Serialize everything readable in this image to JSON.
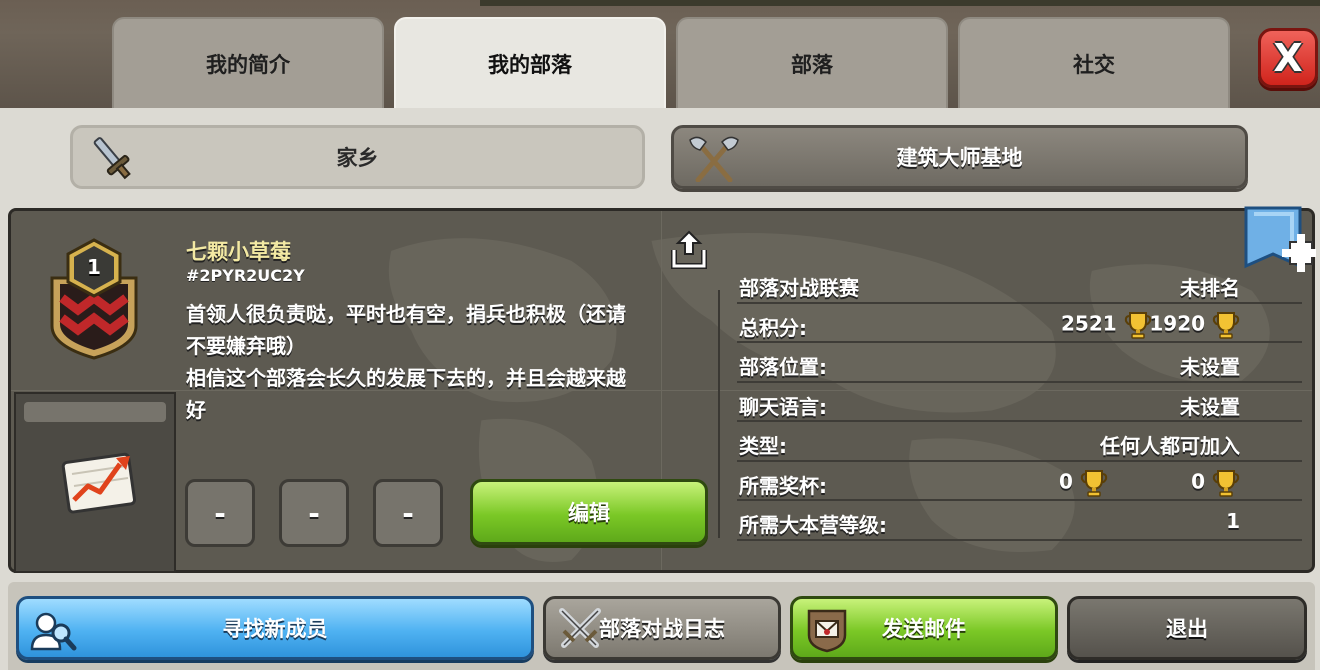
{
  "tabs": [
    {
      "label": "我的简介",
      "active": false
    },
    {
      "label": "我的部落",
      "active": true
    },
    {
      "label": "部落",
      "active": false
    },
    {
      "label": "社交",
      "active": false
    }
  ],
  "close_label": "X",
  "subtabs": {
    "home": {
      "label": "家乡",
      "icon": "sword-icon"
    },
    "builder": {
      "label": "建筑大师基地",
      "icon": "crossed-axes-icon"
    }
  },
  "clan": {
    "level": "1",
    "name": "七颗小草莓",
    "tag": "#2PYR2UC2Y",
    "description_lines": [
      "首领人很负责哒，平时也有空，捐兵也积极（还请",
      "不要嫌弃哦）",
      "相信这个部落会长久的发展下去的，并且会越来越",
      "好"
    ]
  },
  "action_buttons": {
    "dash1": "-",
    "dash2": "-",
    "dash3": "-",
    "edit": "编辑"
  },
  "stats": {
    "war_league": {
      "label": "部落对战联赛",
      "value": "未排名"
    },
    "total_points": {
      "label": "总积分:",
      "value": "2521",
      "value2": "1920"
    },
    "location": {
      "label": "部落位置:",
      "value": "未设置"
    },
    "chat_language": {
      "label": "聊天语言:",
      "value": "未设置"
    },
    "type": {
      "label": "类型:",
      "value": "任何人都可加入"
    },
    "required_trophies": {
      "label": "所需奖杯:",
      "value": "0",
      "value2": "0"
    },
    "required_townhall": {
      "label": "所需大本营等级:",
      "value": "1"
    }
  },
  "bottom_buttons": {
    "find_members": "寻找新成员",
    "war_log": "部落对战日志",
    "send_mail": "发送邮件",
    "leave": "退出"
  },
  "colors": {
    "accent_green": "#7bc826",
    "accent_blue": "#4fb2f2",
    "close_red": "#d0241c",
    "clan_name_yellow": "#f3e9a3"
  }
}
